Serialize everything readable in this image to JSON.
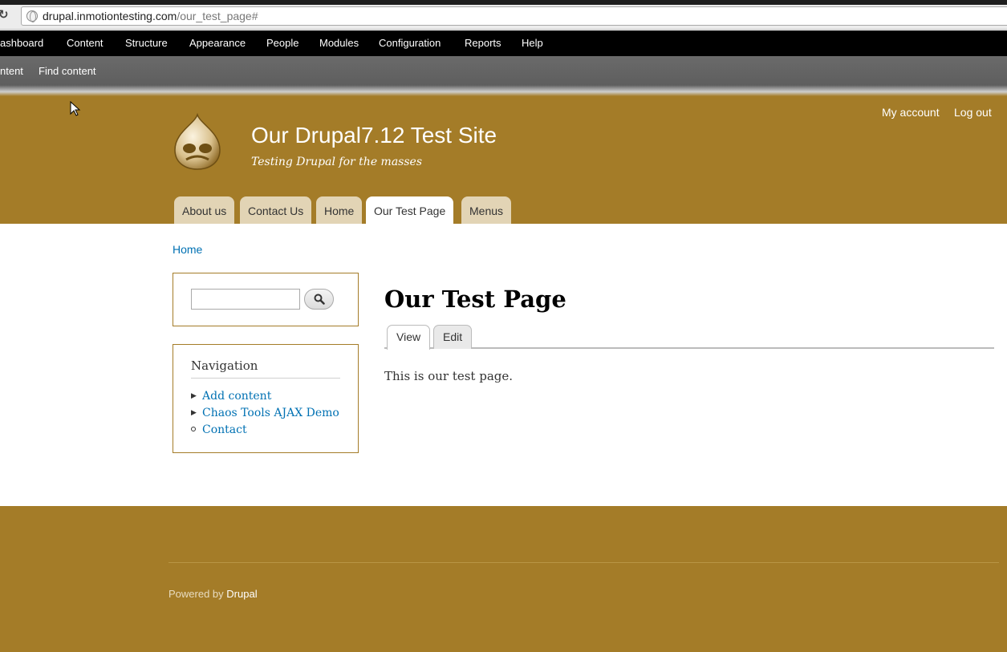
{
  "browser": {
    "url_host": "drupal.inmotiontesting.com",
    "url_path": "/our_test_page#"
  },
  "admin_toolbar": {
    "items": [
      "ashboard",
      "Content",
      "Structure",
      "Appearance",
      "People",
      "Modules",
      "Configuration",
      "Reports",
      "Help"
    ]
  },
  "shortcuts": {
    "items": [
      "ntent",
      "Find content"
    ]
  },
  "header": {
    "site_name": "Our Drupal7.12 Test Site",
    "slogan": "Testing Drupal for the masses",
    "secondary_menu": [
      "My account",
      "Log out"
    ],
    "main_menu": [
      {
        "label": "About us",
        "active": false
      },
      {
        "label": "Contact Us",
        "active": false
      },
      {
        "label": "Home",
        "active": false
      },
      {
        "label": "Our Test Page",
        "active": true
      },
      {
        "label": "Menus",
        "active": false
      }
    ],
    "background_color": "#a47c28"
  },
  "breadcrumb": "Home",
  "sidebar": {
    "search": {
      "value": "",
      "button_icon": "search-icon"
    },
    "navigation": {
      "title": "Navigation",
      "items": [
        {
          "label": "Add content",
          "marker": "collapsed"
        },
        {
          "label": "Chaos Tools AJAX Demo",
          "marker": "collapsed"
        },
        {
          "label": "Contact",
          "marker": "leaf"
        }
      ]
    }
  },
  "main": {
    "title": "Our Test Page",
    "tabs": [
      {
        "label": "View",
        "active": true
      },
      {
        "label": "Edit",
        "active": false
      }
    ],
    "body": "This is our test page."
  },
  "footer": {
    "powered_by": "Powered by",
    "drupal_link": "Drupal"
  },
  "colors": {
    "link": "#0071b3",
    "accent": "#a47c28"
  }
}
